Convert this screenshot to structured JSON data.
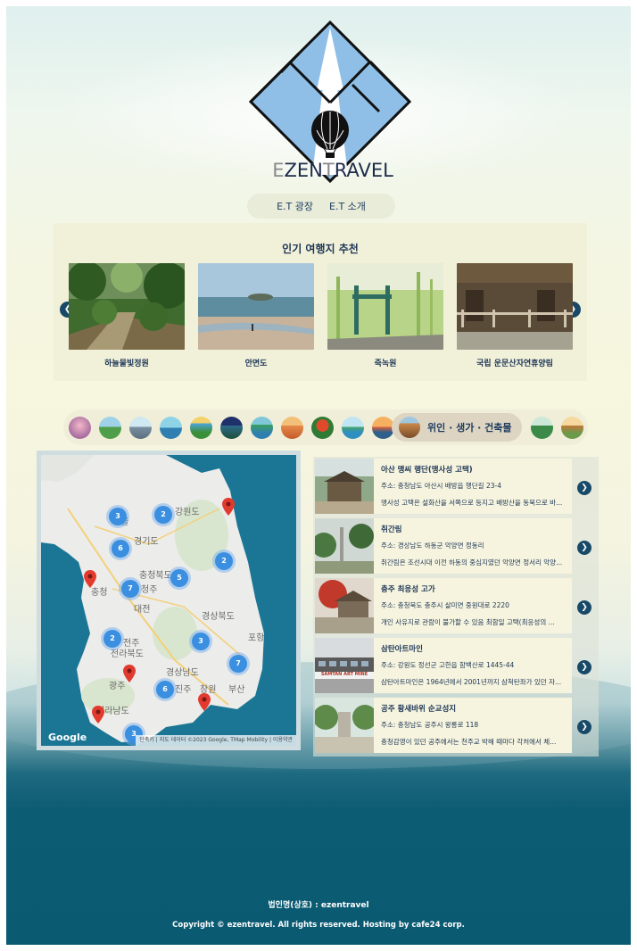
{
  "brand": {
    "logo_text_first": "E",
    "logo_text_rest": "ZEN",
    "logo_text_mid": "T",
    "logo_text_end": "RAVEL"
  },
  "nav": {
    "items": [
      {
        "label": "E.T 광장"
      },
      {
        "label": "E.T 소개"
      }
    ]
  },
  "recommend": {
    "title": "인기 여행지 추천",
    "cards": [
      {
        "caption": "하늘물빛정원"
      },
      {
        "caption": "안면도"
      },
      {
        "caption": "죽녹원"
      },
      {
        "caption": "국립 운문산자연휴양림"
      }
    ],
    "prev_icon": "chevron-left-icon",
    "next_icon": "chevron-right-icon"
  },
  "categories": {
    "active_label": "위인 · 생가 · 건축물"
  },
  "map": {
    "labels": [
      "강원도",
      "서울",
      "경기도",
      "충청북도",
      "청주",
      "충청",
      "대전",
      "경상북도",
      "전주",
      "전라북도",
      "경상남도",
      "광주",
      "진주",
      "창원",
      "부산",
      "전라남도",
      "포항"
    ],
    "clusters": [
      "3",
      "2",
      "6",
      "5",
      "7",
      "2",
      "2",
      "3",
      "7",
      "6",
      "3"
    ],
    "google": "Google",
    "footer": "단축키 | 지도 데이터 ©2023 Google, TMap Mobility | 이용약관"
  },
  "places": [
    {
      "name": "아산 맹씨 행단(맹사성 고택)",
      "address": "주소: 충청남도 아산시 배방읍 행단길 23-4",
      "desc": "맹사성 고택은 설화산을 서쪽으로 등지고 배방산을 동북으로 바..."
    },
    {
      "name": "취간림",
      "address": "주소: 경상남도 하동군 악양면 정동리",
      "desc": "취간림은 조선시대 이전 하동의 중심지였던 악양면 정서리 악양..."
    },
    {
      "name": "충주 최응성 고가",
      "address": "주소: 충청북도 충주시 살미면 중원대로 2220",
      "desc": "개인 사유지로 관람이 불가할 수 있음 최함일 고택(최응성의 ..."
    },
    {
      "name": "삼탄아트마인",
      "address": "주소: 강원도 정선군 고한읍 함백산로 1445-44",
      "desc": "삼탄아트마인은 1964년에서 2001년까지 삼척탄좌가 있던 자..."
    },
    {
      "name": "공주 황새바위 순교성지",
      "address": "주소: 충청남도 공주시 왕릉로 118",
      "desc": "충청감영이 있던 공주에서는 천주교 박해 때마다 각처에서 체..."
    }
  ],
  "thumb_caption": "SAMTAN ART MINE",
  "footer": {
    "company": "법인명(상호) : ezentravel",
    "copyright": "Copyright © ezentravel. All rights reserved. Hosting by cafe24 corp."
  }
}
